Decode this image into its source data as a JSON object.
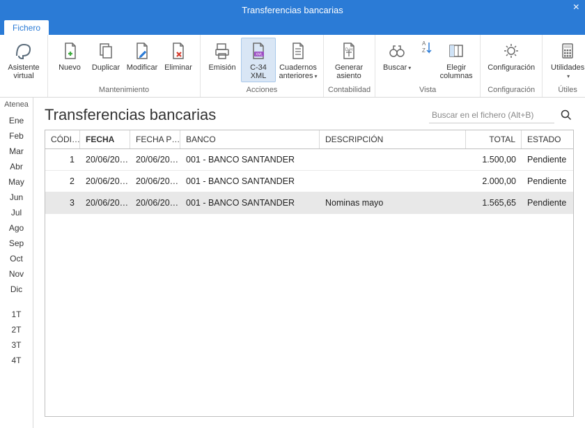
{
  "window": {
    "title": "Transferencias bancarias"
  },
  "tabs": {
    "fichero": "Fichero"
  },
  "ribbon": {
    "groups": {
      "asistente": {
        "label": "Asistente\nvirtual"
      },
      "mantenimiento": {
        "label": "Mantenimiento",
        "nuevo": "Nuevo",
        "duplicar": "Duplicar",
        "modificar": "Modificar",
        "eliminar": "Eliminar"
      },
      "acciones": {
        "label": "Acciones",
        "emision": "Emisión",
        "c34": "C-34\nXML",
        "cuadernos": "Cuadernos\nanteriores"
      },
      "contabilidad": {
        "label": "Contabilidad",
        "generar": "Generar\nasiento"
      },
      "vista": {
        "label": "Vista",
        "buscar": "Buscar",
        "az": "",
        "elegir": "Elegir\ncolumnas"
      },
      "config": {
        "label": "Configuración",
        "btn": "Configuración"
      },
      "utiles": {
        "label": "Útiles",
        "btn": "Utilidades"
      }
    }
  },
  "sidebar": {
    "atenea": "Atenea",
    "months": [
      "Ene",
      "Feb",
      "Mar",
      "Abr",
      "May",
      "Jun",
      "Jul",
      "Ago",
      "Sep",
      "Oct",
      "Nov",
      "Dic"
    ],
    "quarters": [
      "1T",
      "2T",
      "3T",
      "4T"
    ]
  },
  "page": {
    "title": "Transferencias bancarias",
    "search_placeholder": "Buscar en el fichero (Alt+B)"
  },
  "table": {
    "headers": {
      "codi": "CÓDI…",
      "fecha": "FECHA",
      "fechap": "FECHA P…",
      "banco": "BANCO",
      "descripcion": "DESCRIPCIÓN",
      "total": "TOTAL",
      "estado": "ESTADO"
    },
    "rows": [
      {
        "codi": "1",
        "fecha": "20/06/20…",
        "fechap": "20/06/20…",
        "banco": "001 - BANCO SANTANDER",
        "descripcion": "",
        "total": "1.500,00",
        "estado": "Pendiente"
      },
      {
        "codi": "2",
        "fecha": "20/06/20…",
        "fechap": "20/06/20…",
        "banco": "001 - BANCO SANTANDER",
        "descripcion": "",
        "total": "2.000,00",
        "estado": "Pendiente"
      },
      {
        "codi": "3",
        "fecha": "20/06/20…",
        "fechap": "20/06/20…",
        "banco": "001 - BANCO SANTANDER",
        "descripcion": "Nominas mayo",
        "total": "1.565,65",
        "estado": "Pendiente"
      }
    ],
    "selected_index": 2
  }
}
